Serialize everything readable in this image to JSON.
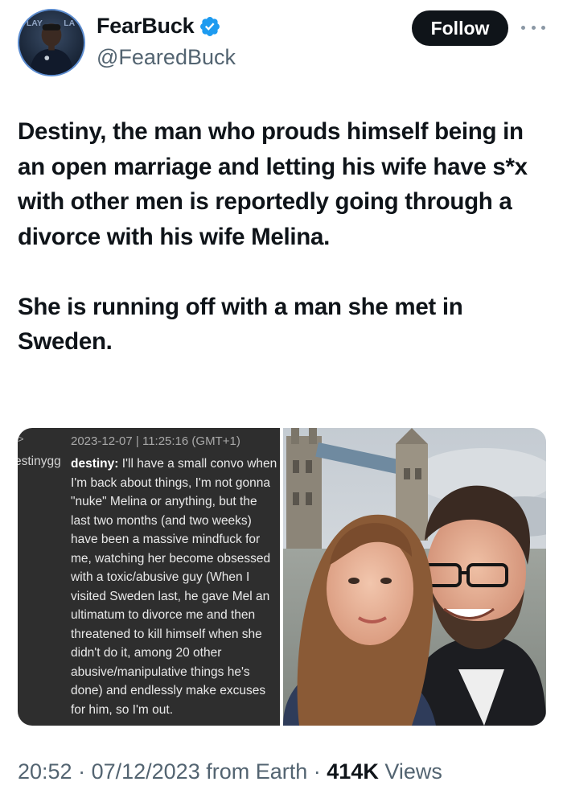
{
  "author": {
    "display_name": "FearBuck",
    "handle": "@FearedBuck",
    "verified": true,
    "avatar_icon": "profile-photo",
    "avatar_backdrop_text": "PLAY"
  },
  "actions": {
    "follow_label": "Follow",
    "more_icon": "more-horizontal-icon"
  },
  "tweet": {
    "paragraphs": [
      "Destiny, the man who prouds himself being in an open marriage and letting his wife have s*x with other men is reportedly going through a divorce with his wife Melina.",
      "She is running off with a man she met in Sweden."
    ]
  },
  "media": {
    "chat_screenshot": {
      "edge_glyph": ">",
      "timestamp": "2023-12-07 | 11:25:16 (GMT+1)",
      "cut_username": "estinygg",
      "author": "destiny:",
      "first_line_rest": " I'll have a small convo when",
      "lines": [
        "I'm back about things, I'm not gonna",
        "\"nuke\" Melina or anything, but the",
        "last two months (and two weeks)",
        "have been a massive mindfuck for",
        "me, watching her become obsessed",
        "with a toxic/abusive guy (When I",
        "visited Sweden last, he gave Mel an",
        "ultimatum to divorce me and then",
        "threatened to kill himself when she",
        "didn't do it, among 20 other",
        "abusive/manipulative things he's",
        "done) and endlessly make excuses",
        "for him, so I'm out."
      ]
    },
    "photo": {
      "icon": "selfie-photo"
    }
  },
  "meta": {
    "time": "20:52",
    "separator": " · ",
    "date": "07/12/2023",
    "location": "from Earth",
    "views_count": "414K",
    "views_label": " Views"
  },
  "colors": {
    "text": "#0f1419",
    "secondary": "#536471",
    "verified": "#1d9bf0",
    "button_bg": "#0f1419",
    "chat_bg": "#2e2e2e"
  }
}
